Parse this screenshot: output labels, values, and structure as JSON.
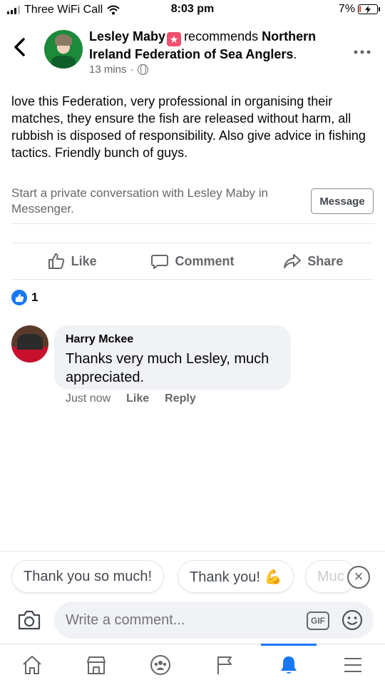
{
  "status_bar": {
    "carrier": "Three WiFi Call",
    "time": "8:03 pm",
    "battery_percent": "7%",
    "battery_level": 0.07
  },
  "post": {
    "author": "Lesley Maby",
    "recommends_text": "recommends",
    "page_name": "Northern Ireland Federation of Sea Anglers",
    "page_name_suffix": ".",
    "timestamp": "13 mins",
    "separator": "·",
    "body": "love this Federation, very professional in organising their matches, they ensure the fish are released without harm, all rubbish is disposed of responsibility. Also give advice in fishing tactics. Friendly bunch of guys.",
    "messenger_prompt": "Start a private conversation with Lesley Maby in Messenger.",
    "message_button": "Message"
  },
  "actions": {
    "like": "Like",
    "comment": "Comment",
    "share": "Share"
  },
  "reactions": {
    "count": "1"
  },
  "comment": {
    "author": "Harry Mckee",
    "text": "Thanks very much Lesley, much appreciated.",
    "time": "Just now",
    "like": "Like",
    "reply": "Reply"
  },
  "quick_replies": [
    "Thank you so much!",
    "Thank you! 💪",
    "Muc"
  ],
  "composer": {
    "placeholder": "Write a comment...",
    "gif_label": "GIF"
  },
  "nav": {
    "items": [
      "home-icon",
      "marketplace-icon",
      "groups-icon",
      "pages-icon",
      "notifications-icon",
      "menu-icon"
    ],
    "active": "notifications-icon"
  },
  "colors": {
    "accent": "#1877f2",
    "muted_text": "#65676b",
    "bubble": "#f0f2f5",
    "badge": "#f0506e",
    "battery_low": "#e53935"
  }
}
